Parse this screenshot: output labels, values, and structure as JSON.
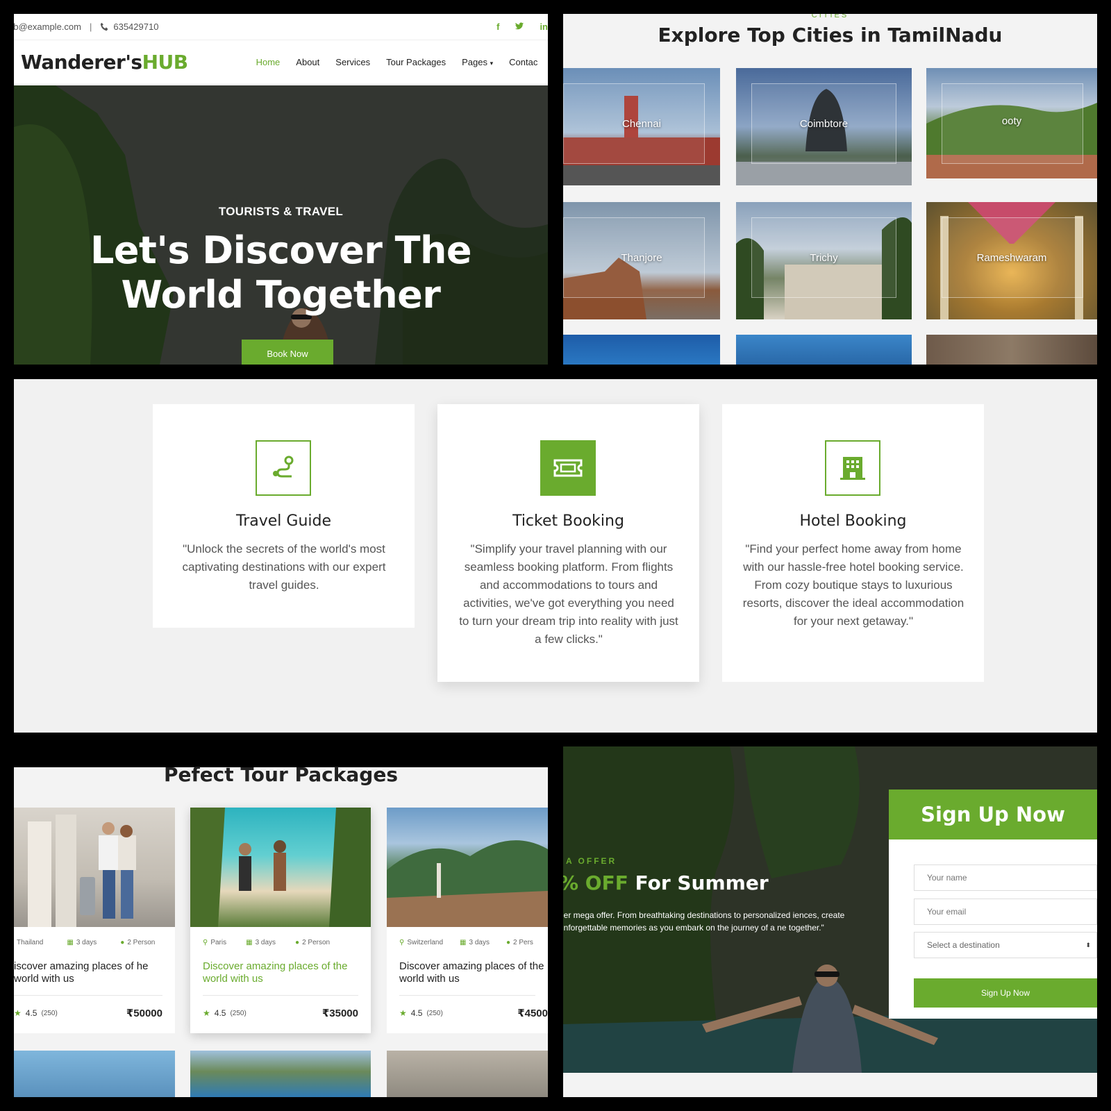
{
  "brand": {
    "name_part1": "Wanderer's",
    "name_part2": "HUB",
    "accent": "#6aab2e"
  },
  "topbar": {
    "email": "ub@example.com",
    "separator": "|",
    "phone": "635429710",
    "social_icons": [
      "facebook-icon",
      "twitter-icon",
      "linkedin-icon"
    ]
  },
  "nav": {
    "items": [
      "Home",
      "About",
      "Services",
      "Tour Packages",
      "Pages",
      "Contac"
    ],
    "active": "Home"
  },
  "hero": {
    "subtitle": "TOURISTS & TRAVEL",
    "title_line1": "Let's Discover The",
    "title_line2": "World Together",
    "button": "Book Now"
  },
  "cities": {
    "tag": "CITIES",
    "title": "Explore Top Cities in TamilNadu",
    "items": [
      "Chennai",
      "Coimbtore",
      "ooty",
      "Thanjore",
      "Trichy",
      "Rameshwaram"
    ]
  },
  "services": [
    {
      "title": "Travel Guide",
      "text": "\"Unlock the secrets of the world's most captivating destinations with our expert travel guides.",
      "icon": "route-icon"
    },
    {
      "title": "Ticket Booking",
      "text": "\"Simplify your travel planning with our seamless booking platform. From flights and accommodations to tours and activities, we've got everything you need to turn your dream trip into reality with just a few clicks.\"",
      "icon": "ticket-icon"
    },
    {
      "title": "Hotel Booking",
      "text": "\"Find your perfect home away from home with our hassle-free hotel booking service. From cozy boutique stays to luxurious resorts, discover the ideal accommodation for your next getaway.\"",
      "icon": "hotel-icon"
    }
  ],
  "packages": {
    "title": "Pefect Tour Packages",
    "cards": [
      {
        "location": "Thailand",
        "days": "3 days",
        "persons": "2 Person",
        "title": "iscover amazing places of he world with us",
        "rating": "4.5",
        "reviews": "(250)",
        "price": "₹50000"
      },
      {
        "location": "Paris",
        "days": "3 days",
        "persons": "2 Person",
        "title": "Discover amazing places of the world with us",
        "rating": "4.5",
        "reviews": "(250)",
        "price": "₹35000"
      },
      {
        "location": "Switzerland",
        "days": "3 days",
        "persons": "2 Pers",
        "title": "Discover amazing places of the world with us",
        "rating": "4.5",
        "reviews": "(250)",
        "price": "₹4500"
      }
    ]
  },
  "offer": {
    "tag": "A OFFER",
    "title_green": "% OFF",
    "title_white": "For Summer",
    "text": "ner mega offer. From breathtaking destinations to personalized iences, create unforgettable memories as you embark on the journey of a ne together.\""
  },
  "signup": {
    "title": "Sign Up Now",
    "name_placeholder": "Your name",
    "email_placeholder": "Your email",
    "select_value": "Select a destination",
    "button": "Sign Up Now"
  }
}
